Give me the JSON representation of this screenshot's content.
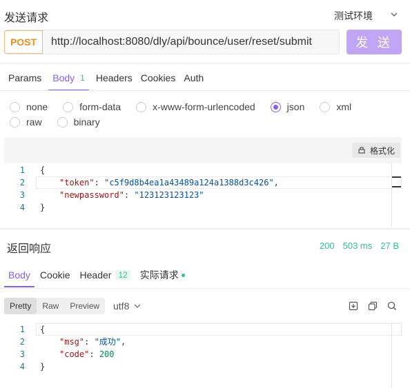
{
  "header": {
    "title": "发送请求",
    "environment": "测试环境"
  },
  "request": {
    "method": "POST",
    "url": "http://localhost:8080/dly/api/bounce/user/reset/submit",
    "send_label": "发 送"
  },
  "tabs": [
    {
      "label": "Params",
      "badge": ""
    },
    {
      "label": "Body",
      "badge": "1",
      "active": true
    },
    {
      "label": "Headers",
      "badge": ""
    },
    {
      "label": "Cookies",
      "badge": ""
    },
    {
      "label": "Auth",
      "badge": ""
    }
  ],
  "body_types": [
    {
      "label": "none",
      "checked": false
    },
    {
      "label": "form-data",
      "checked": false
    },
    {
      "label": "x-www-form-urlencoded",
      "checked": false
    },
    {
      "label": "json",
      "checked": true
    },
    {
      "label": "xml",
      "checked": false
    },
    {
      "label": "raw",
      "checked": false
    },
    {
      "label": "binary",
      "checked": false
    }
  ],
  "editor": {
    "format_label": "格式化",
    "lines": [
      {
        "n": "1",
        "text": "{"
      },
      {
        "n": "2",
        "key": "\"token\"",
        "value": "\"c5f9d8b4ea1a43489a124a1388d3c426\"",
        "tail": ","
      },
      {
        "n": "3",
        "key": "\"newpassword\"",
        "value": "\"123123123123\"",
        "tail": ""
      },
      {
        "n": "4",
        "text": "}"
      }
    ]
  },
  "response": {
    "title": "返回响应",
    "status": "200",
    "time": "503 ms",
    "size": "27 B",
    "tabs": [
      {
        "label": "Body",
        "badge": "",
        "active": true
      },
      {
        "label": "Cookie",
        "badge": ""
      },
      {
        "label": "Header",
        "badge": "12"
      },
      {
        "label": "实际请求",
        "badge": ""
      }
    ],
    "view_modes": [
      "Pretty",
      "Raw",
      "Preview"
    ],
    "active_view": "Pretty",
    "encoding": "utf8",
    "lines": [
      {
        "n": "1",
        "text": "{"
      },
      {
        "n": "2",
        "key": "\"msg\"",
        "value": "\"成功\"",
        "tail": ",",
        "value_type": "string"
      },
      {
        "n": "3",
        "key": "\"code\"",
        "value": "200",
        "tail": "",
        "value_type": "number"
      },
      {
        "n": "4",
        "text": "}"
      }
    ]
  },
  "colors": {
    "accent": "#8a5cf6",
    "method": "#f58a1f",
    "send_button": "#c2a6f6",
    "success": "#2fbf9a"
  }
}
